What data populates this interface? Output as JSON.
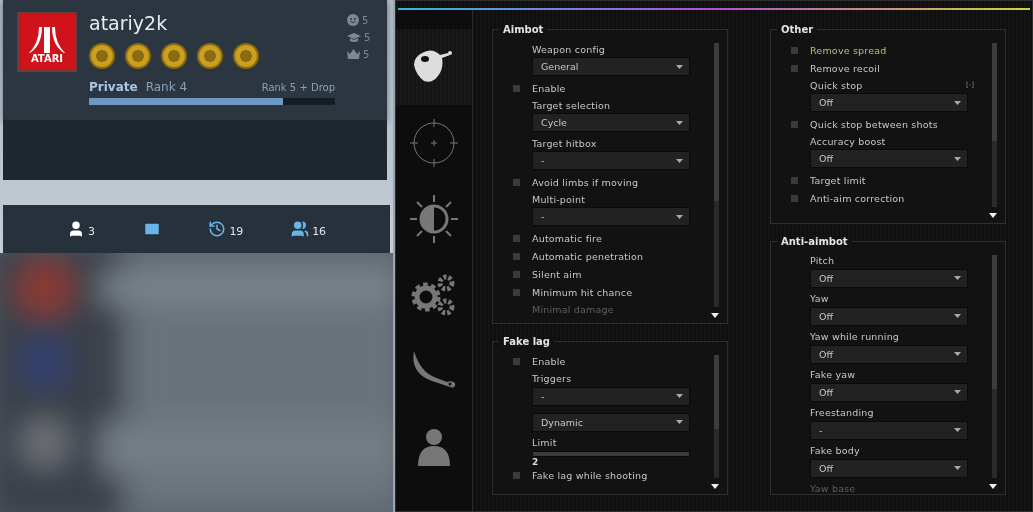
{
  "profile": {
    "logo_text": "ATARI",
    "name": "atariy2k",
    "stats": [
      {
        "kind": "smile",
        "value": "5"
      },
      {
        "kind": "cap",
        "value": "5"
      },
      {
        "kind": "crown",
        "value": "5"
      }
    ],
    "rank_title": "Private",
    "rank": "Rank 4",
    "next_rank": "Rank 5 + Drop",
    "level": 0.79
  },
  "social": [
    {
      "kind": "friends",
      "count": "3"
    },
    {
      "kind": "mail"
    },
    {
      "kind": "history",
      "count": "19"
    },
    {
      "kind": "groups",
      "count": "16"
    }
  ],
  "menu": {
    "tabs": [
      {
        "kind": "face",
        "selected": true
      },
      {
        "kind": "crosshair",
        "selected": false
      },
      {
        "kind": "visuals",
        "selected": false
      },
      {
        "kind": "gears",
        "selected": false
      },
      {
        "kind": "knife",
        "selected": false
      },
      {
        "kind": "player",
        "selected": false
      }
    ],
    "columns": [
      [
        {
          "title": "Aimbot",
          "items": [
            {
              "kind": "dropdown",
              "label": "Weapon config",
              "value": "General"
            },
            {
              "kind": "checkbox",
              "label": "Enable",
              "checked": false,
              "highlighted": false
            },
            {
              "kind": "dropdown",
              "label": "Target selection",
              "value": "Cycle"
            },
            {
              "kind": "dropdown",
              "label": "Target hitbox",
              "value": "-"
            },
            {
              "kind": "checkbox",
              "label": "Avoid limbs if moving",
              "checked": false,
              "highlighted": false
            },
            {
              "kind": "dropdown",
              "label": "Multi-point",
              "value": "-"
            },
            {
              "kind": "checkbox",
              "label": "Automatic fire",
              "checked": false,
              "highlighted": false
            },
            {
              "kind": "checkbox",
              "label": "Automatic penetration",
              "checked": false,
              "highlighted": false
            },
            {
              "kind": "checkbox",
              "label": "Silent aim",
              "checked": false,
              "highlighted": false
            },
            {
              "kind": "checkbox",
              "label": "Minimum hit chance",
              "checked": false,
              "highlighted": false
            },
            {
              "kind": "label",
              "label": "Minimal damage",
              "disabled": true
            }
          ]
        },
        {
          "title": "Fake lag",
          "items": [
            {
              "kind": "checkbox",
              "label": "Enable",
              "checked": false,
              "highlighted": false
            },
            {
              "kind": "dropdown",
              "label": "Triggers",
              "value": "-"
            },
            {
              "kind": "dropdown",
              "value": "Dynamic"
            },
            {
              "kind": "slider",
              "label": "Limit",
              "level": 0,
              "reading": "2"
            },
            {
              "kind": "checkbox",
              "label": "Fake lag while shooting",
              "checked": false,
              "highlighted": false
            }
          ]
        }
      ],
      [
        {
          "title": "Other",
          "items": [
            {
              "kind": "checkbox",
              "label": "Remove spread",
              "checked": false,
              "highlighted": true
            },
            {
              "kind": "checkbox",
              "label": "Remove recoil",
              "checked": false,
              "highlighted": false
            },
            {
              "kind": "dropdown",
              "label": "Quick stop",
              "value": "Off",
              "hotkey": "[-]"
            },
            {
              "kind": "checkbox",
              "label": "Quick stop between shots",
              "checked": false,
              "highlighted": false
            },
            {
              "kind": "dropdown",
              "label": "Accuracy boost",
              "value": "Off"
            },
            {
              "kind": "checkbox",
              "label": "Target limit",
              "checked": false,
              "highlighted": false
            },
            {
              "kind": "checkbox",
              "label": "Anti-aim correction",
              "checked": false,
              "highlighted": false
            }
          ]
        },
        {
          "title": "Anti-aimbot",
          "items": [
            {
              "kind": "dropdown",
              "label": "Pitch",
              "value": "Off"
            },
            {
              "kind": "dropdown",
              "label": "Yaw",
              "value": "Off"
            },
            {
              "kind": "dropdown",
              "label": "Yaw while running",
              "value": "Off"
            },
            {
              "kind": "dropdown",
              "label": "Fake yaw",
              "value": "Off"
            },
            {
              "kind": "dropdown",
              "label": "Freestanding",
              "value": "-"
            },
            {
              "kind": "dropdown",
              "label": "Fake body",
              "value": "Off"
            },
            {
              "kind": "label",
              "label": "Yaw base",
              "disabled": true
            }
          ]
        }
      ]
    ]
  }
}
